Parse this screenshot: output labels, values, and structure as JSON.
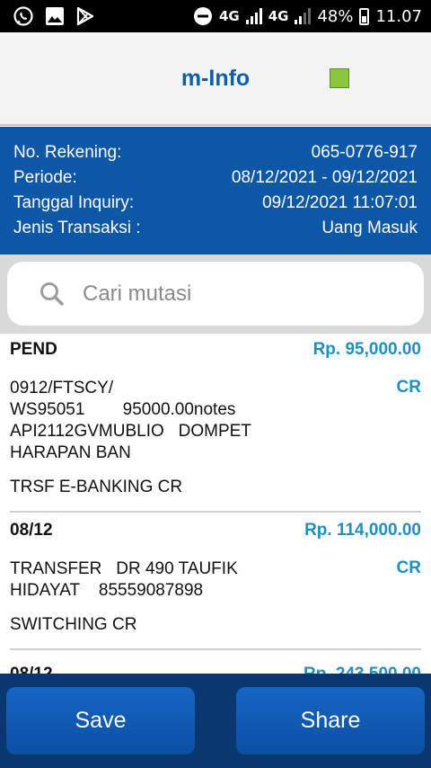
{
  "statusbar": {
    "net1": "4G",
    "net2": "4G",
    "battery": "48%",
    "time": "11.07"
  },
  "header": {
    "title": "m-Info",
    "status_color": "#8cc63f"
  },
  "info": {
    "rows": [
      {
        "label": "No. Rekening:",
        "value": "065-0776-917"
      },
      {
        "label": "Periode:",
        "value": "08/12/2021 - 09/12/2021"
      },
      {
        "label": "Tanggal Inquiry:",
        "value": "09/12/2021 11:07:01"
      },
      {
        "label": "Jenis Transaksi :",
        "value": "Uang Masuk"
      }
    ]
  },
  "search": {
    "placeholder": "Cari mutasi"
  },
  "transactions": [
    {
      "date": "PEND",
      "amount": "Rp. 95,000.00",
      "type": "CR",
      "desc": "0912/FTSCY/\nWS95051        95000.00notes\nAPI2112GVMUBLIO   DOMPET\nHARAPAN BAN",
      "sub": "TRSF E-BANKING CR"
    },
    {
      "date": "08/12",
      "amount": "Rp. 114,000.00",
      "type": "CR",
      "desc": "TRANSFER   DR 490 TAUFIK\nHIDAYAT    85559087898",
      "sub": "SWITCHING CR"
    },
    {
      "date": "08/12",
      "amount": "Rp. 243,500.00",
      "type": "",
      "desc": "",
      "sub": ""
    }
  ],
  "actions": {
    "save_label": "Save",
    "share_label": "Share"
  },
  "colors": {
    "primary": "#0d58a6",
    "accent": "#1f8fc0",
    "bottom": "#0a3770"
  }
}
